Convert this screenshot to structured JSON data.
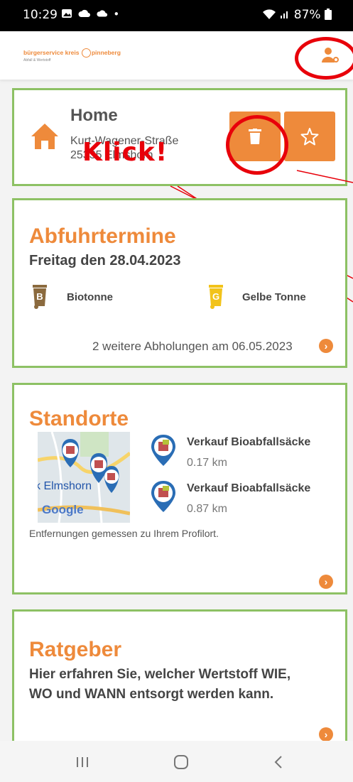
{
  "status_bar": {
    "time": "10:29",
    "battery": "87%",
    "signal": "▾.▎▍"
  },
  "header": {
    "logo_main_a": "bürgerservice kreis",
    "logo_main_b": "pinneberg",
    "logo_sub": "Abfall & Wertstoff"
  },
  "home_card": {
    "title": "Home",
    "address_line1": "Kurt-Wagener-Straße",
    "address_line2": "25335 Elmshorn",
    "annotation": "Klick!"
  },
  "pickup_card": {
    "title": "Abfuhrtermine",
    "date": "Freitag den 28.04.2023",
    "bins": [
      {
        "letter": "B",
        "label": "Biotonne",
        "color": "#8b6a3e"
      },
      {
        "letter": "G",
        "label": "Gelbe Tonne",
        "color": "#f2c31a"
      }
    ],
    "more_link": "2 weitere Abholungen am 06.05.2023"
  },
  "locations_card": {
    "title": "Standorte",
    "map_label": "k Elmshorn",
    "map_brand": "Google",
    "items": [
      {
        "name": "Verkauf Bioabfallsäcke",
        "distance": "0.17 km"
      },
      {
        "name": "Verkauf Bioabfallsäcke",
        "distance": "0.87 km"
      }
    ],
    "note": "Entfernungen gemessen zu Ihrem Profilort."
  },
  "advisor_card": {
    "title": "Ratgeber",
    "text_line1": "Hier erfahren Sie, welcher Wertstoff WIE,",
    "text_line2": "WO und WANN entsorgt werden kann."
  },
  "colors": {
    "accent": "#ee8a3b",
    "card_border": "#8dc164",
    "annotation": "#e8000a"
  },
  "icons": [
    "image-icon",
    "cloud-icon",
    "wifi-icon",
    "battery-icon",
    "user-settings-icon",
    "house-icon",
    "trash-icon",
    "star-icon",
    "bin-icon",
    "map-pin-icon",
    "arrow-right-icon",
    "recents-icon",
    "home-nav-icon",
    "back-icon"
  ]
}
